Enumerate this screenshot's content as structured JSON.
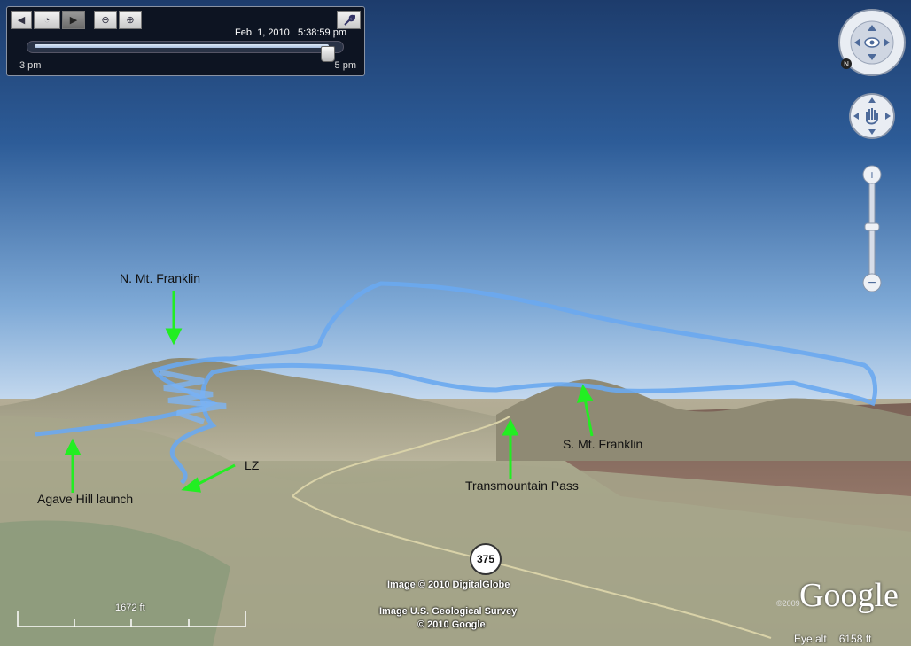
{
  "time_slider": {
    "timestamp": "Feb  1, 2010   5:38:59 pm",
    "start_label": "3 pm",
    "end_label": "5 pm",
    "position": 0.97
  },
  "map_labels": {
    "n_mt_franklin": "N. Mt. Franklin",
    "lz": "LZ",
    "agave_hill": "Agave Hill launch",
    "transmountain_pass": "Transmountain Pass",
    "s_mt_franklin": "S. Mt. Franklin"
  },
  "road_shield": "375",
  "attribution": {
    "line1": "Image © 2010 DigitalGlobe",
    "line2": "Image U.S. Geological Survey",
    "line3": "© 2010 Google"
  },
  "logo": "Google",
  "logo_year": "©2009",
  "scale": "1672 ft",
  "status": {
    "eye_alt_label": "Eye alt",
    "eye_alt_value": "6158 ft"
  },
  "colors": {
    "track": "#6aa8f0",
    "arrow": "#22ee22",
    "sky_top": "#1c3d6e",
    "sky_horizon": "#c4d9ef"
  }
}
